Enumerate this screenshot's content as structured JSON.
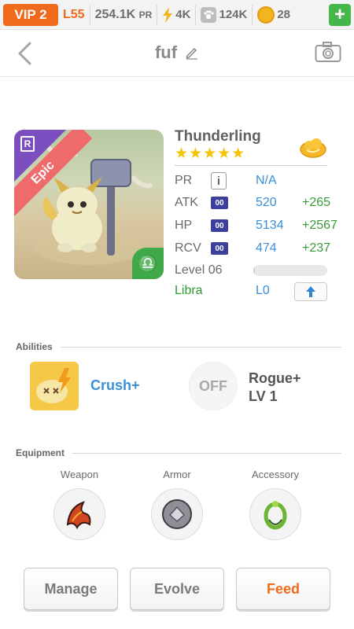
{
  "topbar": {
    "vip": "VIP 2",
    "level": "L55",
    "pr_value": "254.1K",
    "pr_unit": "PR",
    "energy": "4K",
    "paws": "124K",
    "coins": "28",
    "plus_label": "+"
  },
  "header": {
    "title": "fuf"
  },
  "monster": {
    "name": "Thunderling",
    "stars": "★★★★★",
    "rarity_letter": "R",
    "rarity_label": "Epic",
    "zodiac_glyph": "♎",
    "stats": [
      {
        "label": "PR",
        "value": "N/A",
        "bonus": ""
      },
      {
        "label": "ATK",
        "tag": "00",
        "value": "520",
        "bonus": "+265"
      },
      {
        "label": "HP",
        "tag": "00",
        "value": "5134",
        "bonus": "+2567"
      },
      {
        "label": "RCV",
        "tag": "00",
        "value": "474",
        "bonus": "+237"
      }
    ],
    "info_glyph": "i",
    "level_label": "Level 06",
    "xp_fraction": 0.02,
    "zodiac_name": "Libra",
    "zodiac_level": "L0"
  },
  "abilities": {
    "title": "Abilities",
    "active_name": "Crush+",
    "passive_state": "OFF",
    "passive_name_line1": "Rogue+",
    "passive_name_line2": "LV 1"
  },
  "equipment": {
    "title": "Equipment",
    "slots": [
      {
        "label": "Weapon"
      },
      {
        "label": "Armor"
      },
      {
        "label": "Accessory"
      }
    ]
  },
  "actions": {
    "manage": "Manage",
    "evolve": "Evolve",
    "feed": "Feed"
  },
  "colors": {
    "accent_orange": "#f06a1c",
    "link_blue": "#3a8fd6",
    "bonus_green": "#3a9a3a",
    "star_yellow": "#f5c400"
  }
}
